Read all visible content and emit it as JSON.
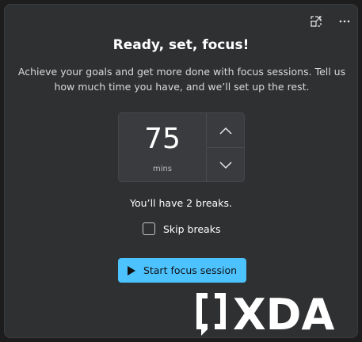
{
  "header": {
    "title": "Ready, set, focus!",
    "description": "Achieve your goals and get more done with focus sessions. Tell us how much time you have, and we’ll set up the rest."
  },
  "stepper": {
    "value": "75",
    "unit": "mins"
  },
  "breaks_text": "You’ll have 2 breaks.",
  "skip_breaks": {
    "label": "Skip breaks",
    "checked": false
  },
  "start_button": {
    "label": "Start focus session"
  },
  "icons": {
    "pin": "pin-window-icon",
    "more": "more-options-icon",
    "up": "chevron-up-icon",
    "down": "chevron-down-icon",
    "play": "play-icon"
  },
  "watermark": {
    "text": "XDA"
  },
  "colors": {
    "accent": "#4cc2ff",
    "card_bg": "#2f3032"
  }
}
